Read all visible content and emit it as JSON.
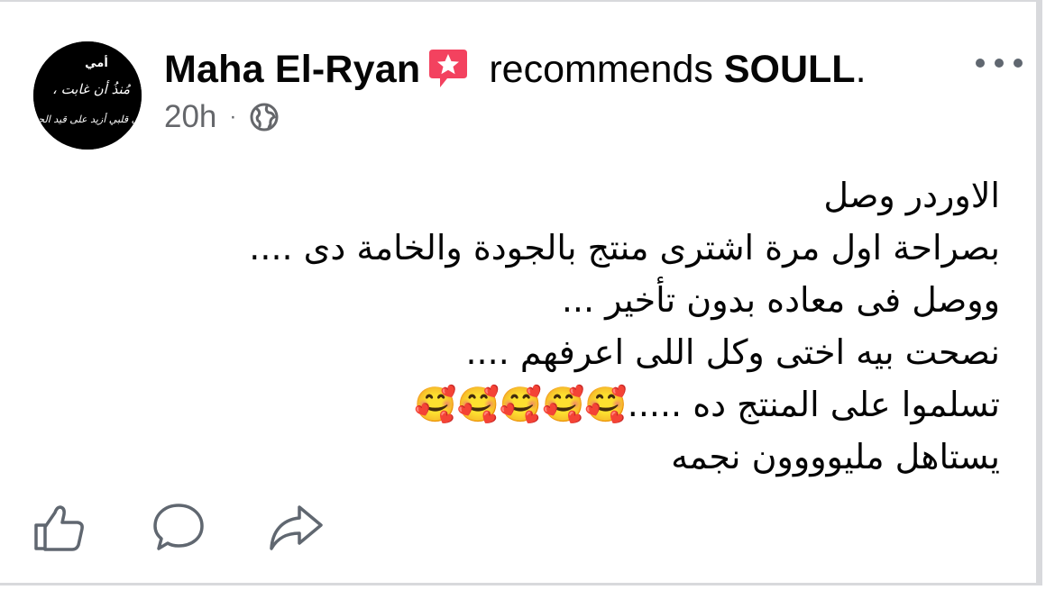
{
  "post": {
    "author": "Maha El-Ryan",
    "verb": "recommends",
    "page_name": "SOULL",
    "period": ".",
    "time": "20h",
    "separator": "·",
    "privacy_icon": "globe-icon",
    "badge_icon": "star-speech-bubble-icon",
    "more_icon": "ellipsis-icon",
    "body_lines": [
      "الاوردر وصل",
      "بصراحة اول مرة اشترى منتج بالجودة والخامة دى ....",
      "ووصل فى معاده بدون تأخير ...",
      "نصحت بيه اختى وكل اللى اعرفهم ....",
      "تسلموا على المنتج ده .....🥰🥰🥰🥰🥰",
      "يستاهل مليوووون نجمه"
    ]
  },
  "avatar": {
    "lines": [
      "أمي",
      "مُنذُ أن غابت ،",
      "في قلبي أزيد على قيد الحياة"
    ]
  },
  "actions": {
    "like_icon": "thumbs-up-icon",
    "comment_icon": "comment-bubble-icon",
    "share_icon": "share-arrow-icon"
  },
  "colors": {
    "text": "#050505",
    "secondary_text": "#65676b",
    "icon": "#606770",
    "badge": "#f3425f",
    "border": "#d8d9dc"
  }
}
